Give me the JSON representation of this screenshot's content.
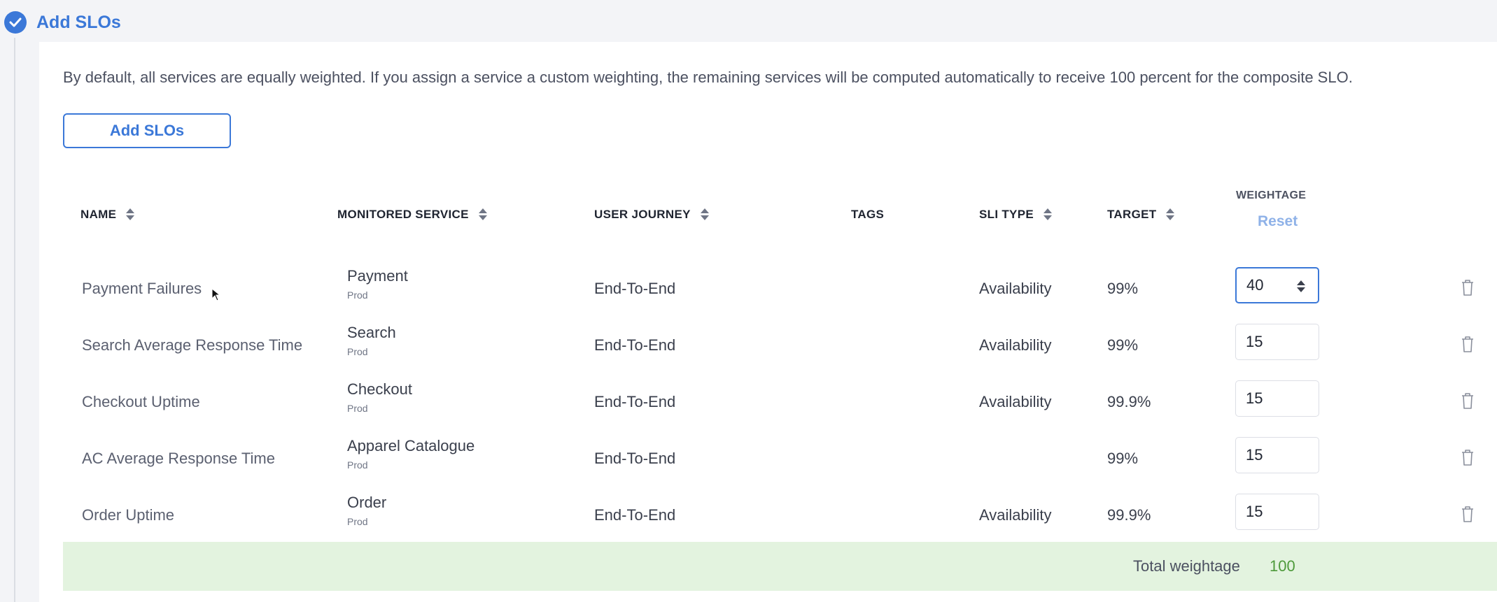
{
  "section": {
    "title": "Add SLOs"
  },
  "description": "By default, all services are equally weighted. If you assign a service a custom weighting, the remaining services will be computed automatically to receive 100 percent for the composite SLO.",
  "add_button_label": "Add SLOs",
  "columns": {
    "name": "NAME",
    "monitored_service": "MONITORED SERVICE",
    "user_journey": "USER JOURNEY",
    "tags": "TAGS",
    "sli_type": "SLI TYPE",
    "target": "TARGET",
    "weightage": "WEIGHTAGE",
    "reset": "Reset"
  },
  "rows": [
    {
      "name": "Payment Failures",
      "service": "Payment",
      "env": "Prod",
      "journey": "End-To-End",
      "sli_type": "Availability",
      "target": "99%",
      "weight": "40"
    },
    {
      "name": "Search Average Response Time",
      "service": "Search",
      "env": "Prod",
      "journey": "End-To-End",
      "sli_type": "Availability",
      "target": "99%",
      "weight": "15"
    },
    {
      "name": "Checkout Uptime",
      "service": "Checkout",
      "env": "Prod",
      "journey": "End-To-End",
      "sli_type": "Availability",
      "target": "99.9%",
      "weight": "15"
    },
    {
      "name": "AC Average Response Time",
      "service": "Apparel Catalogue",
      "env": "Prod",
      "journey": "End-To-End",
      "sli_type": "",
      "target": "99%",
      "weight": "15"
    },
    {
      "name": "Order Uptime",
      "service": "Order",
      "env": "Prod",
      "journey": "End-To-End",
      "sli_type": "Availability",
      "target": "99.9%",
      "weight": "15"
    }
  ],
  "total": {
    "label": "Total weightage",
    "value": "100"
  },
  "colors": {
    "accent": "#3b78d8",
    "total_bg": "#e3f3df",
    "total_value": "#4e9a3b"
  }
}
